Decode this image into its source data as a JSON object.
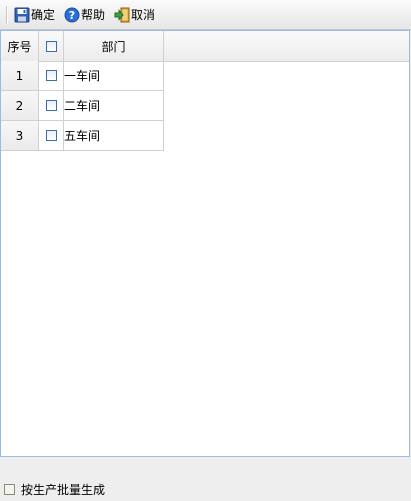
{
  "toolbar": {
    "confirm_label": "确定",
    "help_label": "帮助",
    "cancel_label": "取消"
  },
  "table": {
    "headers": {
      "num": "序号",
      "dept": "部门"
    },
    "rows": [
      {
        "num": "1",
        "dept": "一车间"
      },
      {
        "num": "2",
        "dept": "二车间"
      },
      {
        "num": "3",
        "dept": "五车间"
      }
    ]
  },
  "footer": {
    "batch_label": "按生产批量生成"
  },
  "colors": {
    "border_accent": "#99bbe8",
    "checkbox_border": "#3d6da6"
  }
}
